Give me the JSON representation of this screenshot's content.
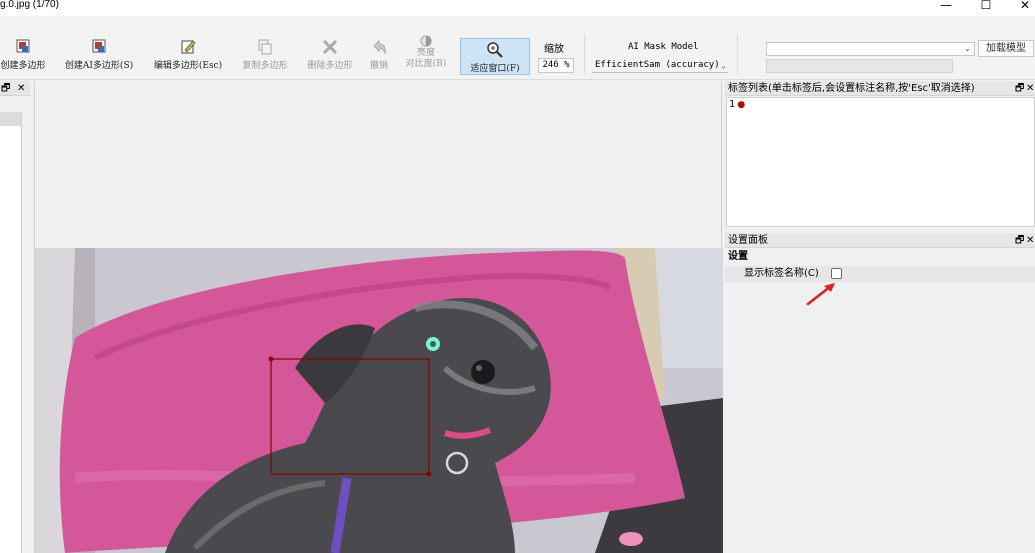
{
  "window": {
    "title": "g.0.jpg (1/70)",
    "min_icon": "minimize-icon",
    "max_icon": "maximize-icon",
    "close_icon": "close-icon",
    "min_glyph": "—",
    "max_glyph": "☐",
    "close_glyph": "✕"
  },
  "toolbar": {
    "create_polygon": "创建多边形",
    "create_ai_polygon": "创建AI多边形(S)",
    "edit_polygon": "编辑多边形(Esc)",
    "copy_polygon": "复制多边形",
    "delete_polygon": "删除多边形",
    "undo": "撤销",
    "brightness_line1": "亮度",
    "brightness_line2": "对比度(B)",
    "fit_window": "适应窗口(F)",
    "zoom_label": "缩放",
    "zoom_value": "246 %",
    "model_label": "AI Mask Model",
    "model_value": "EfficientSam (accuracy)",
    "load_model": "加载模型"
  },
  "label_list": {
    "title": "标签列表(单击标签后,会设置标注名称,按'Esc'取消选择)",
    "items": [
      {
        "index": "1",
        "color": "#c00000"
      }
    ]
  },
  "settings_panel": {
    "title": "设置面板",
    "section": "设置",
    "show_label_name": "显示标签名称(C)",
    "show_label_name_checked": false
  },
  "dock_controls": {
    "float_glyph": "🗗",
    "close_glyph": "✕"
  },
  "colors": {
    "accent_active": "#cfe3f7",
    "annotation_box": "#8b0000",
    "arrow": "#e02020"
  }
}
